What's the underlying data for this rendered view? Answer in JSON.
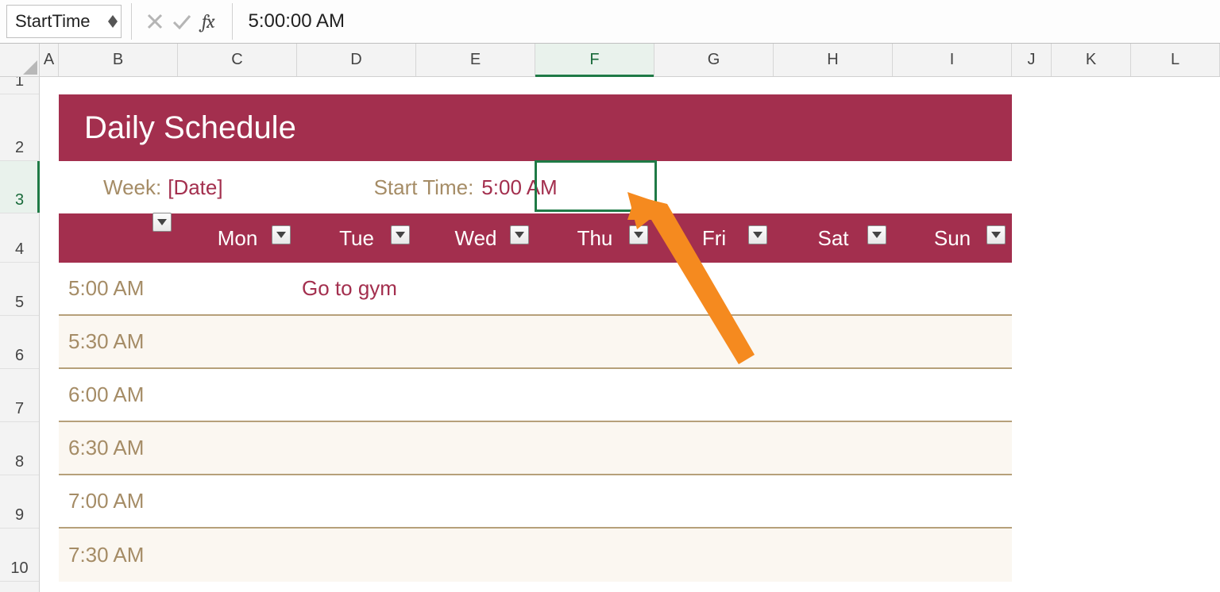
{
  "formula_bar": {
    "name_box": "StartTime",
    "fx_label": "fx",
    "value": "5:00:00 AM"
  },
  "columns": [
    "A",
    "B",
    "C",
    "D",
    "E",
    "F",
    "G",
    "H",
    "I",
    "J",
    "K",
    "L"
  ],
  "active_column": "F",
  "rows": [
    "1",
    "2",
    "3",
    "4",
    "5",
    "6",
    "7",
    "8",
    "9",
    "10"
  ],
  "active_row": "3",
  "schedule": {
    "title": "Daily Schedule",
    "week_label": "Week:",
    "week_value": "[Date]",
    "start_time_label": "Start Time:",
    "start_time_value": "5:00 AM",
    "days": [
      "Mon",
      "Tue",
      "Wed",
      "Thu",
      "Fri",
      "Sat",
      "Sun"
    ],
    "slots": [
      {
        "time": "5:00 AM",
        "entries": [
          "",
          "Go to gym",
          "",
          "",
          "",
          "",
          ""
        ]
      },
      {
        "time": "5:30 AM",
        "entries": [
          "",
          "",
          "",
          "",
          "",
          "",
          ""
        ]
      },
      {
        "time": "6:00 AM",
        "entries": [
          "",
          "",
          "",
          "",
          "",
          "",
          ""
        ]
      },
      {
        "time": "6:30 AM",
        "entries": [
          "",
          "",
          "",
          "",
          "",
          "",
          ""
        ]
      },
      {
        "time": "7:00 AM",
        "entries": [
          "",
          "",
          "",
          "",
          "",
          "",
          ""
        ]
      },
      {
        "time": "7:30 AM",
        "entries": [
          "",
          "",
          "",
          "",
          "",
          "",
          ""
        ]
      }
    ]
  }
}
